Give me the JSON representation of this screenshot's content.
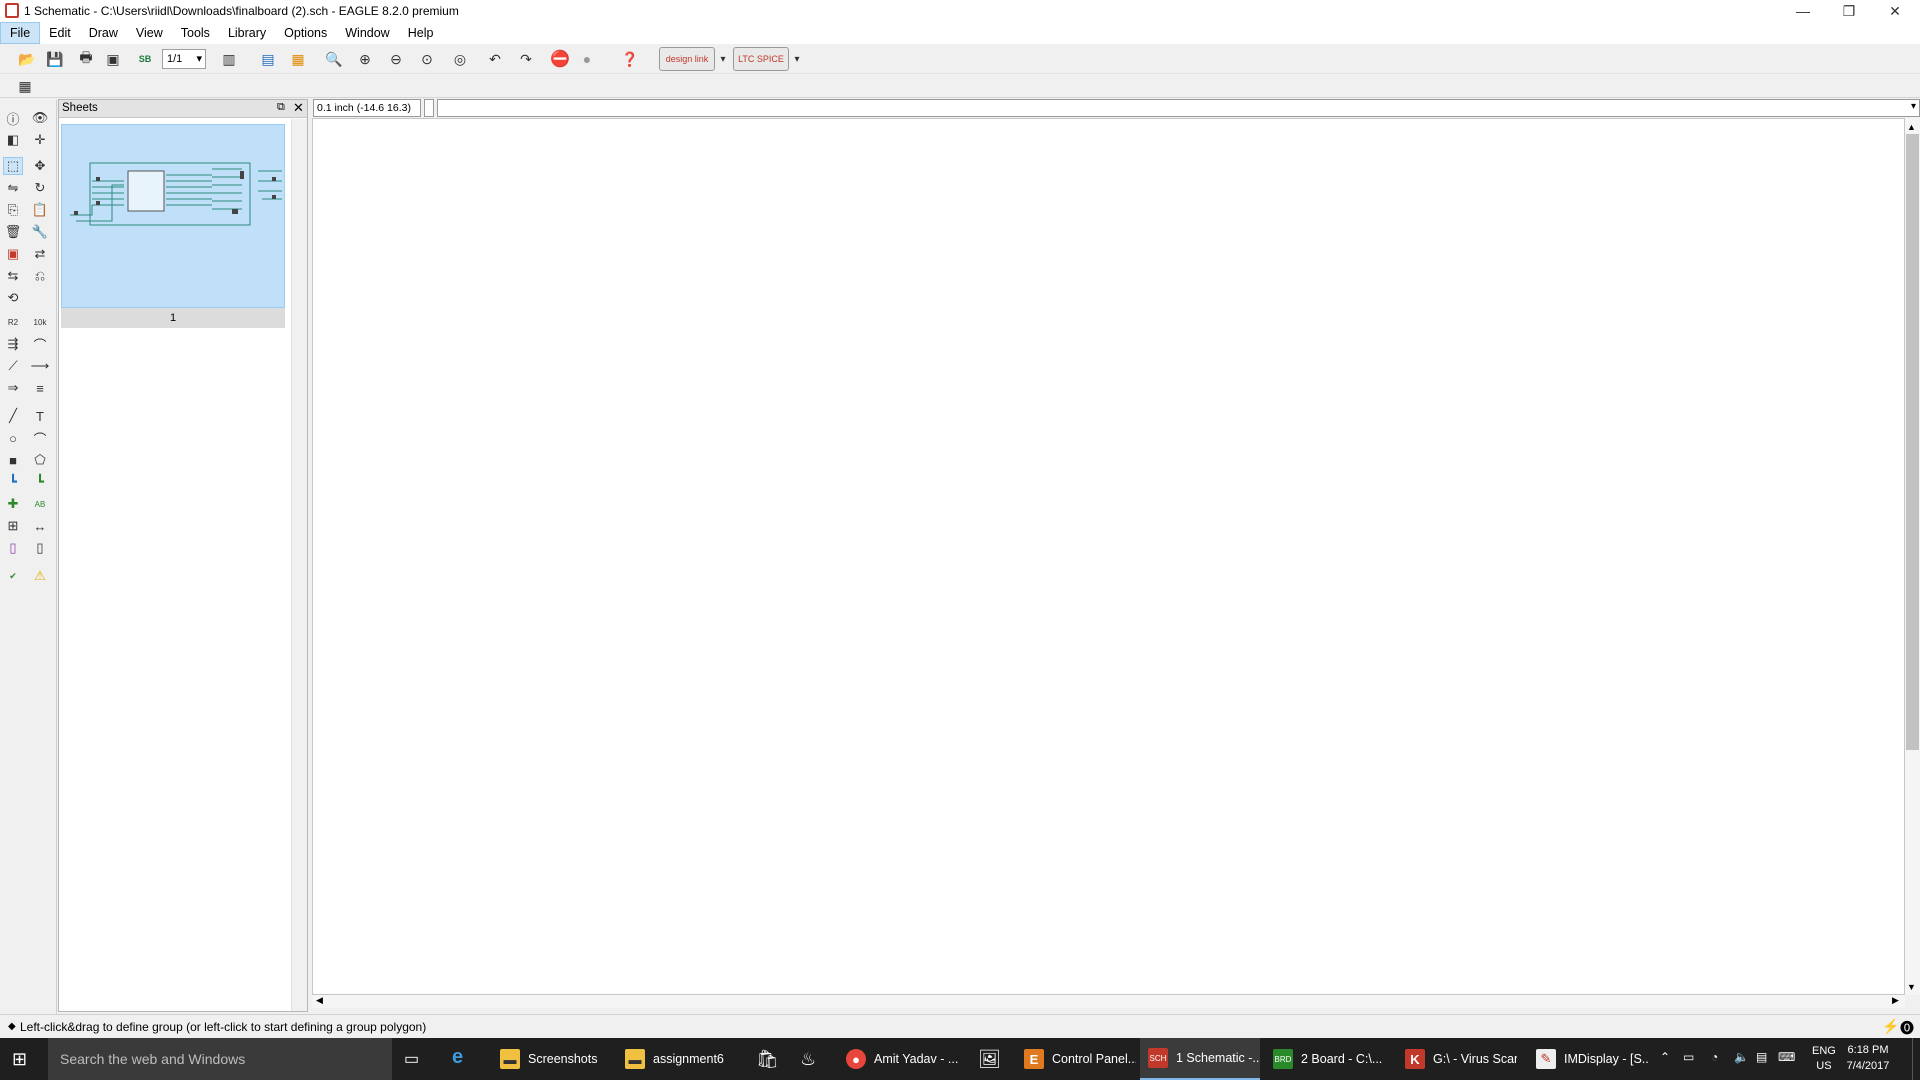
{
  "window": {
    "title": "1 Schematic - C:\\Users\\riidl\\Downloads\\finalboard (2).sch - EAGLE 8.2.0 premium",
    "minimize": "—",
    "restore": "❐",
    "close": "✕"
  },
  "menu": [
    "File",
    "Edit",
    "Draw",
    "View",
    "Tools",
    "Library",
    "Options",
    "Window",
    "Help"
  ],
  "toolbar": {
    "sheet_select": "1/1",
    "design_link_label": "design link",
    "ltspice_label": "LTC SPICE"
  },
  "sheets_panel": {
    "title": "Sheets",
    "thumb_label": "1"
  },
  "canvas": {
    "coord_readout": "0.1 inch (-14.6 16.3)",
    "command_value": ""
  },
  "status": {
    "hint": "Left-click&drag to define group (or left-click to start defining a group polygon)"
  },
  "taskbar": {
    "search_placeholder": "Search the web and Windows",
    "items": [
      {
        "label": "Screenshots",
        "icon": "folder-icon"
      },
      {
        "label": "assignment6",
        "icon": "folder-icon"
      },
      {
        "label": "Amit Yadav - ...",
        "icon": "chrome-icon"
      },
      {
        "label": "Control Panel...",
        "icon": "eagle-icon"
      },
      {
        "label": "1 Schematic -...",
        "icon": "schematic-icon"
      },
      {
        "label": "2 Board - C:\\...",
        "icon": "board-icon"
      },
      {
        "label": "G:\\ - Virus Scan",
        "icon": "antivirus-icon"
      },
      {
        "label": "IMDisplay - [S...",
        "icon": "imdisplay-icon"
      }
    ],
    "lang": "ENG",
    "region": "US",
    "time": "6:18 PM",
    "date": "7/4/2017"
  },
  "colors": {
    "accent": "#cce4f7",
    "thumb_bg": "#bfe0f8",
    "taskbar": "#1f1f1f"
  }
}
